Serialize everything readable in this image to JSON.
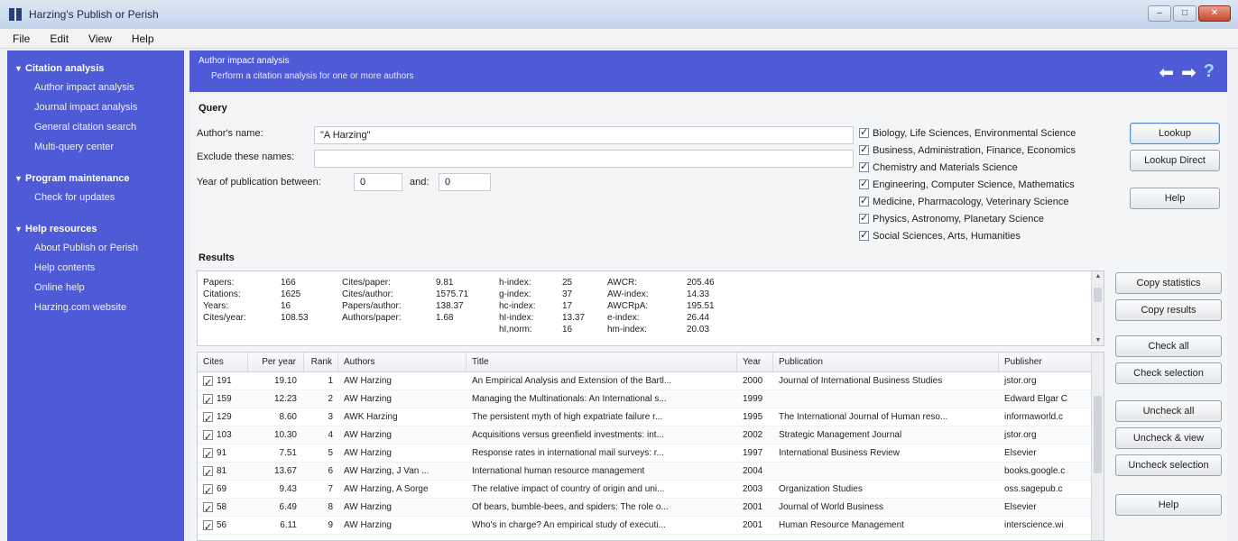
{
  "window": {
    "title": "Harzing's Publish or Perish"
  },
  "menu": [
    "File",
    "Edit",
    "View",
    "Help"
  ],
  "sidebar": {
    "groups": [
      {
        "label": "Citation analysis",
        "items": [
          "Author impact analysis",
          "Journal impact analysis",
          "General citation search",
          "Multi-query center"
        ]
      },
      {
        "label": "Program maintenance",
        "items": [
          "Check for updates"
        ]
      },
      {
        "label": "Help resources",
        "items": [
          "About Publish or Perish",
          "Help contents",
          "Online help",
          "Harzing.com website"
        ]
      }
    ]
  },
  "banner": {
    "title": "Author impact analysis",
    "subtitle": "Perform a citation analysis for one or more authors"
  },
  "query": {
    "section": "Query",
    "author_label": "Author's name:",
    "author_value": "\"A Harzing\"",
    "exclude_label": "Exclude these names:",
    "exclude_value": "",
    "year_label": "Year of publication between:",
    "year_from": "0",
    "and_label": "and:",
    "year_to": "0",
    "subjects": [
      "Biology, Life Sciences, Environmental Science",
      "Business, Administration, Finance, Economics",
      "Chemistry and Materials Science",
      "Engineering, Computer Science, Mathematics",
      "Medicine, Pharmacology, Veterinary Science",
      "Physics, Astronomy, Planetary Science",
      "Social Sciences, Arts, Humanities"
    ],
    "buttons": {
      "lookup": "Lookup",
      "lookup_direct": "Lookup Direct",
      "help": "Help"
    }
  },
  "results": {
    "section": "Results",
    "stats": [
      [
        [
          "Papers:",
          "166"
        ],
        [
          "Citations:",
          "1625"
        ],
        [
          "Years:",
          "16"
        ],
        [
          "Cites/year:",
          "108.53"
        ]
      ],
      [
        [
          "Cites/paper:",
          "9.81"
        ],
        [
          "Cites/author:",
          "1575.71"
        ],
        [
          "Papers/author:",
          "138.37"
        ],
        [
          "Authors/paper:",
          "1.68"
        ]
      ],
      [
        [
          "h-index:",
          "25"
        ],
        [
          "g-index:",
          "37"
        ],
        [
          "hc-index:",
          "17"
        ],
        [
          "hI-index:",
          "13.37"
        ],
        [
          "hI,norm:",
          "16"
        ]
      ],
      [
        [
          "AWCR:",
          "205.46"
        ],
        [
          "AW-index:",
          "14.33"
        ],
        [
          "AWCRpA:",
          "195.51"
        ],
        [
          "e-index:",
          "26.44"
        ],
        [
          "hm-index:",
          "20.03"
        ]
      ]
    ],
    "side_buttons": {
      "copy_statistics": "Copy statistics",
      "copy_results": "Copy results",
      "check_all": "Check all",
      "check_selection": "Check selection",
      "uncheck_all": "Uncheck all",
      "uncheck_view": "Uncheck & view",
      "uncheck_selection": "Uncheck selection",
      "help": "Help"
    },
    "columns": [
      "Cites",
      "Per year",
      "Rank",
      "Authors",
      "Title",
      "Year",
      "Publication",
      "Publisher"
    ],
    "rows": [
      {
        "cites": "191",
        "per_year": "19.10",
        "rank": "1",
        "authors": "AW Harzing",
        "title": "An Empirical Analysis and Extension of the Bartl...",
        "year": "2000",
        "publication": "Journal of International Business Studies",
        "publisher": "jstor.org"
      },
      {
        "cites": "159",
        "per_year": "12.23",
        "rank": "2",
        "authors": "AW Harzing",
        "title": "Managing the Multinationals: An International s...",
        "year": "1999",
        "publication": "",
        "publisher": "Edward Elgar C"
      },
      {
        "cites": "129",
        "per_year": "8.60",
        "rank": "3",
        "authors": "AWK Harzing",
        "title": "The persistent myth of high expatriate failure r...",
        "year": "1995",
        "publication": "The International Journal of Human reso...",
        "publisher": "informaworld.c"
      },
      {
        "cites": "103",
        "per_year": "10.30",
        "rank": "4",
        "authors": "AW Harzing",
        "title": "Acquisitions versus greenfield investments: int...",
        "year": "2002",
        "publication": "Strategic Management Journal",
        "publisher": "jstor.org"
      },
      {
        "cites": "91",
        "per_year": "7.51",
        "rank": "5",
        "authors": "AW Harzing",
        "title": "Response rates in international mail surveys: r...",
        "year": "1997",
        "publication": "International Business Review",
        "publisher": "Elsevier"
      },
      {
        "cites": "81",
        "per_year": "13.67",
        "rank": "6",
        "authors": "AW Harzing, J Van ...",
        "title": "International human resource management",
        "year": "2004",
        "publication": "",
        "publisher": "books.google.c"
      },
      {
        "cites": "69",
        "per_year": "9.43",
        "rank": "7",
        "authors": "AW Harzing, A Sorge",
        "title": "The relative impact of country of origin and uni...",
        "year": "2003",
        "publication": "Organization Studies",
        "publisher": "oss.sagepub.c"
      },
      {
        "cites": "58",
        "per_year": "6.49",
        "rank": "8",
        "authors": "AW Harzing",
        "title": "Of bears, bumble-bees, and spiders: The role o...",
        "year": "2001",
        "publication": "Journal of World Business",
        "publisher": "Elsevier"
      },
      {
        "cites": "56",
        "per_year": "6.11",
        "rank": "9",
        "authors": "AW Harzing",
        "title": "Who's in charge? An empirical study of executi...",
        "year": "2001",
        "publication": "Human Resource Management",
        "publisher": "interscience.wi"
      }
    ]
  }
}
